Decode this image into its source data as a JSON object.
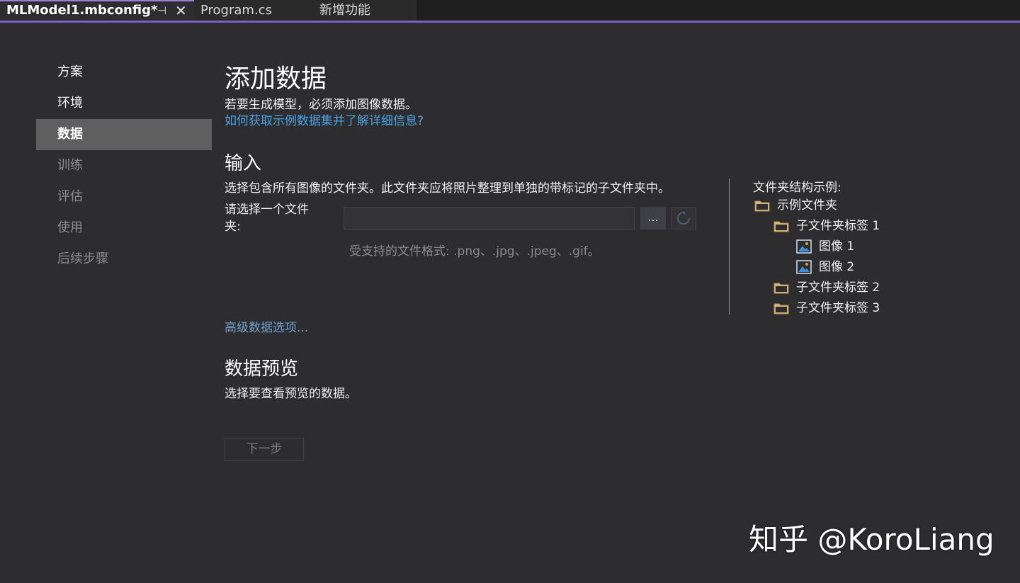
{
  "tabs": [
    {
      "label": "MLModel1.mbconfig*",
      "pin": "⊣",
      "close": "✕"
    },
    {
      "label": "Program.cs"
    },
    {
      "label": "新增功能"
    }
  ],
  "sidebar": {
    "items": [
      {
        "label": "方案"
      },
      {
        "label": "环境"
      },
      {
        "label": "数据"
      },
      {
        "label": "训练"
      },
      {
        "label": "评估"
      },
      {
        "label": "使用"
      },
      {
        "label": "后续步骤"
      }
    ]
  },
  "main": {
    "title": "添加数据",
    "subtitle": "若要生成模型，必须添加图像数据。",
    "info_link": "如何获取示例数据集并了解详细信息?",
    "input_heading": "输入",
    "input_desc": "选择包含所有图像的文件夹。此文件夹应将照片整理到单独的带标记的子文件夹中。",
    "folder_label": "请选择一个文件夹:",
    "folder_value": "",
    "browse_label": "...",
    "supported_formats": "受支持的文件格式: .png、.jpg、.jpeg、.gif。",
    "advanced_link": "高级数据选项...",
    "preview_heading": "数据预览",
    "preview_desc": "选择要查看预览的数据。",
    "next_button": "下一步"
  },
  "folder_structure": {
    "title": "文件夹结构示例:",
    "items": [
      {
        "label": "示例文件夹",
        "icon": "folder-icon"
      },
      {
        "label": "子文件夹标签 1",
        "icon": "folder-icon"
      },
      {
        "label": "图像 1",
        "icon": "image-icon"
      },
      {
        "label": "图像 2",
        "icon": "image-icon"
      },
      {
        "label": "子文件夹标签 2",
        "icon": "folder-icon"
      },
      {
        "label": "子文件夹标签 3",
        "icon": "folder-icon"
      }
    ]
  },
  "watermark": "知乎 @KoroLiang",
  "colors": {
    "background": "#2d2d30",
    "accent": "#7a5fc4",
    "link": "#4aa3e6",
    "selected_nav": "#5f5f5f",
    "folder": "#dcb67a"
  }
}
